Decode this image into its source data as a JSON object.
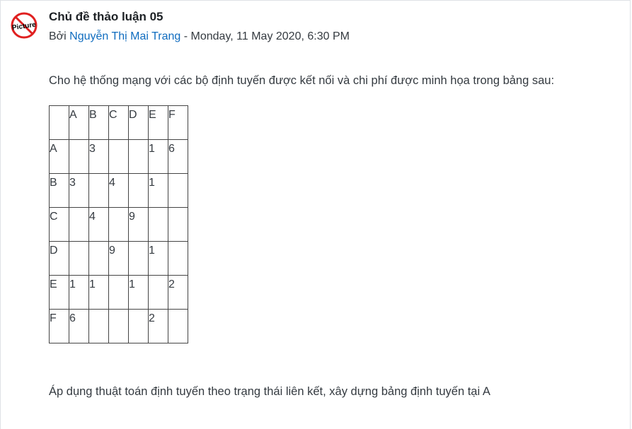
{
  "post": {
    "title": "Chủ đề thảo luận 05",
    "by_prefix": "Bởi",
    "author": "Nguyễn Thị Mai Trang",
    "date_separator": "-",
    "date": "Monday, 11 May 2020, 6:30 PM",
    "avatar_icon": "no-picture-icon",
    "avatar_text": "Picture"
  },
  "content": {
    "intro": "Cho hệ thống mạng với các bộ định tuyến được kết nối và chi phí được minh họa trong bảng sau:",
    "question": "Áp dụng thuật toán định tuyến theo trạng thái liên kết, xây dựng bảng định tuyến tại A",
    "table": {
      "header": [
        "",
        "A",
        "B",
        "C",
        "D",
        "E",
        "F"
      ],
      "rows": [
        [
          "A",
          "",
          "3",
          "",
          "",
          "1",
          "6"
        ],
        [
          "B",
          "3",
          "",
          "4",
          "",
          "1",
          ""
        ],
        [
          "C",
          "",
          "4",
          "",
          "9",
          "",
          ""
        ],
        [
          "D",
          "",
          "",
          "9",
          "",
          "1",
          ""
        ],
        [
          "E",
          "1",
          "1",
          "",
          "1",
          "",
          "2"
        ],
        [
          "F",
          "6",
          "",
          "",
          "",
          "2",
          ""
        ]
      ]
    }
  },
  "colors": {
    "link": "#0f6cbf",
    "text": "#343a40",
    "avatar_red": "#e02020"
  }
}
